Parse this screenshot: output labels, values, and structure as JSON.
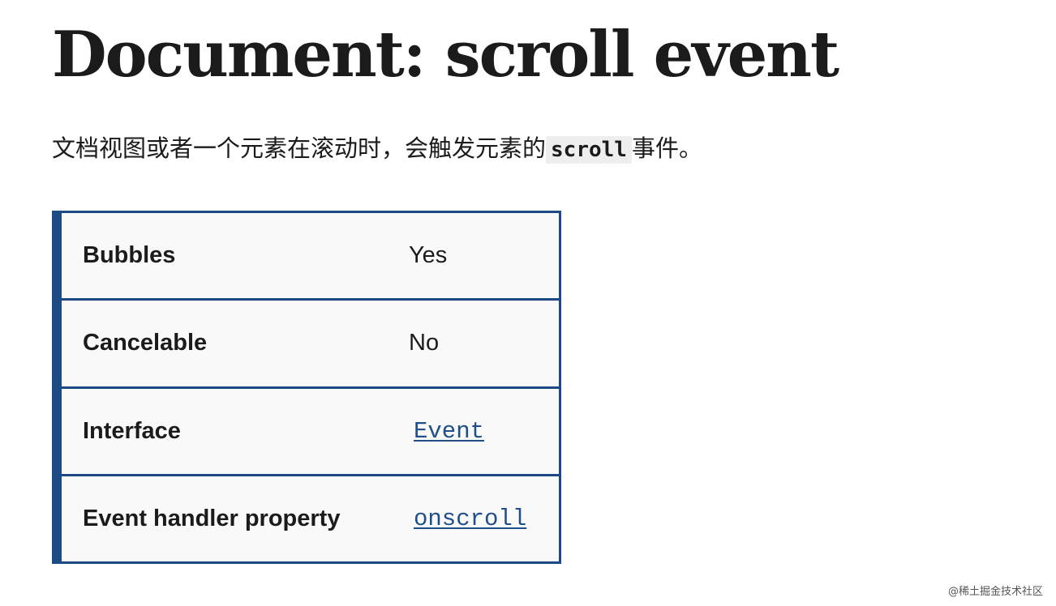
{
  "title": "Document: scroll event",
  "intro": {
    "before_code": "文档视图或者一个元素在滚动时，会触发元素的",
    "code": "scroll",
    "after_code": "事件。"
  },
  "properties": [
    {
      "label": "Bubbles",
      "value": "Yes",
      "is_link": false
    },
    {
      "label": "Cancelable",
      "value": "No",
      "is_link": false
    },
    {
      "label": "Interface",
      "value": "Event",
      "is_link": true
    },
    {
      "label": "Event handler property",
      "value": "onscroll",
      "is_link": true
    }
  ],
  "watermark": "@稀土掘金技术社区",
  "colors": {
    "table_border": "#1c4a82",
    "link": "#1f4f8a",
    "table_bg": "#f9f9f9"
  }
}
